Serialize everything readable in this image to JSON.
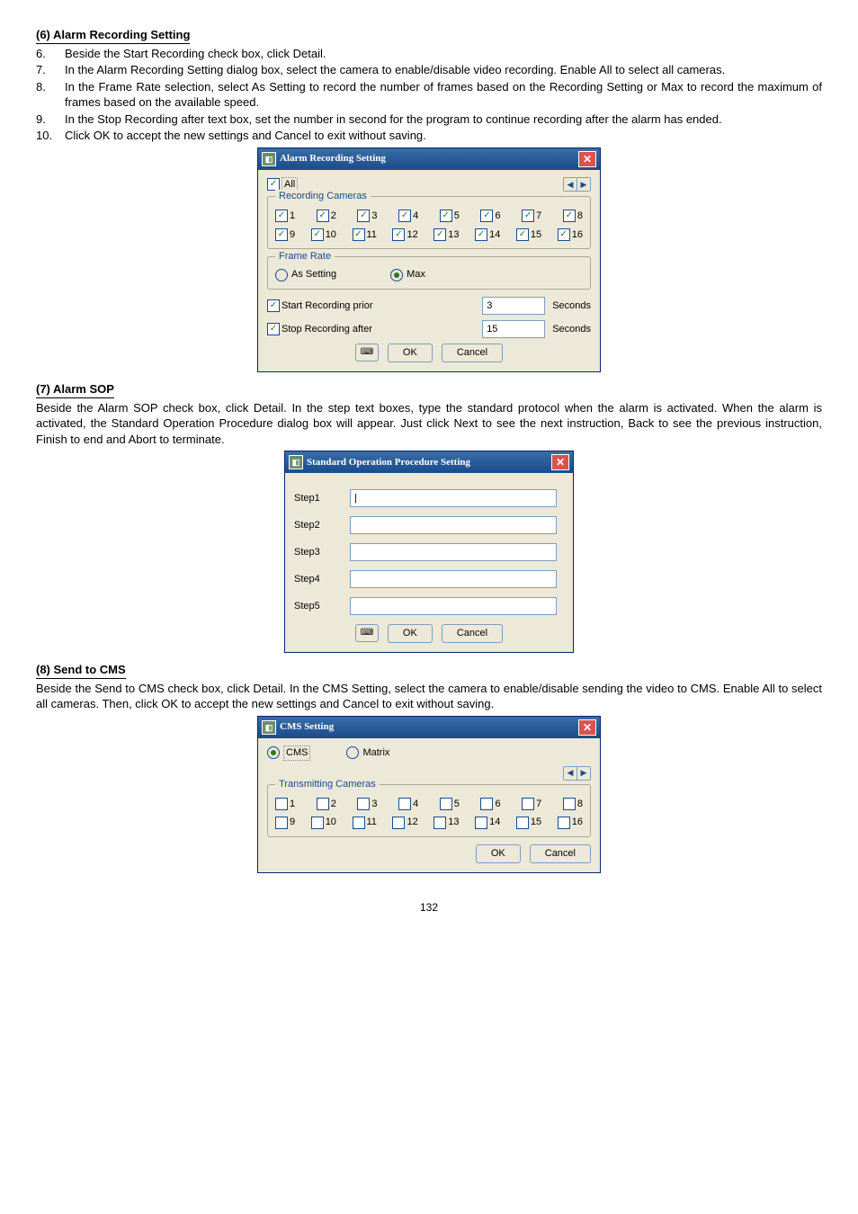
{
  "sectionA": {
    "title": "(6) Alarm Recording Setting",
    "items": [
      {
        "n": "6.",
        "t": "Beside the Start Recording check box, click Detail."
      },
      {
        "n": "7.",
        "t": "In the Alarm Recording Setting dialog box, select the camera to enable/disable video recording. Enable All to select all cameras."
      },
      {
        "n": "8.",
        "t": "In the Frame Rate selection, select As Setting to record the number of frames based on the Recording Setting or Max to record the maximum of frames based on the available speed."
      },
      {
        "n": "9.",
        "t": "In the Stop Recording after text box, set the number in second for the program to continue recording after the alarm has ended."
      },
      {
        "n": "10.",
        "t": "Click OK to accept the new settings and Cancel to exit without saving."
      }
    ]
  },
  "dialog1": {
    "title": "Alarm Recording Setting",
    "all": "All",
    "rec_legend": "Recording Cameras",
    "cams_row1": [
      "1",
      "2",
      "3",
      "4",
      "5",
      "6",
      "7",
      "8"
    ],
    "cams_row2": [
      "9",
      "10",
      "11",
      "12",
      "13",
      "14",
      "15",
      "16"
    ],
    "frame_legend": "Frame Rate",
    "as_setting": "As Setting",
    "max": "Max",
    "start_prior": "Start Recording prior",
    "start_val": "3",
    "stop_after": "Stop Recording after",
    "stop_val": "15",
    "seconds": "Seconds",
    "ok": "OK",
    "cancel": "Cancel"
  },
  "sectionB": {
    "title": "(7) Alarm SOP",
    "para": "Beside the Alarm SOP check box, click Detail. In the step text boxes, type the standard protocol when the alarm is activated. When the alarm is activated, the Standard Operation Procedure dialog box will appear. Just click Next to see the next instruction, Back to see the previous instruction, Finish to end and Abort to terminate."
  },
  "dialog2": {
    "title": "Standard Operation Procedure Setting",
    "steps": [
      "Step1",
      "Step2",
      "Step3",
      "Step4",
      "Step5"
    ],
    "ok": "OK",
    "cancel": "Cancel"
  },
  "sectionC": {
    "title": "(8) Send to CMS",
    "para": "Beside the Send to CMS check box, click Detail. In the CMS Setting, select the camera to enable/disable sending the video to CMS. Enable All to select all cameras. Then, click OK to accept the new settings and Cancel to exit without saving."
  },
  "dialog3": {
    "title": "CMS Setting",
    "cms": "CMS",
    "matrix": "Matrix",
    "trans_legend": "Transmitting Cameras",
    "cams_row1": [
      "1",
      "2",
      "3",
      "4",
      "5",
      "6",
      "7",
      "8"
    ],
    "cams_row2": [
      "9",
      "10",
      "11",
      "12",
      "13",
      "14",
      "15",
      "16"
    ],
    "ok": "OK",
    "cancel": "Cancel"
  },
  "page": "132"
}
